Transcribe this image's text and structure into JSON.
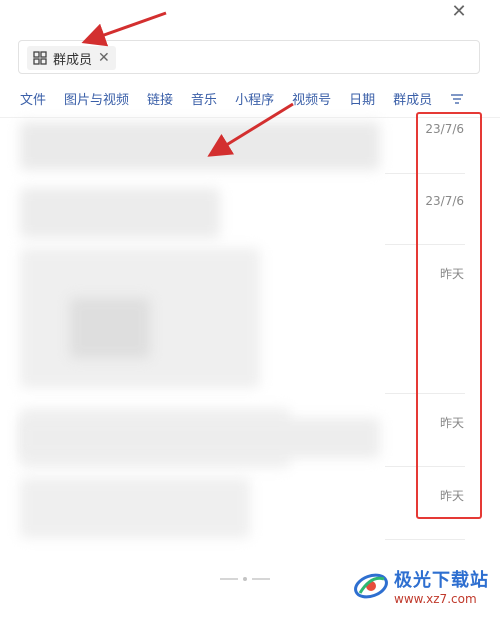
{
  "window": {
    "close_symbol": "✕"
  },
  "search": {
    "chip_label": "群成员",
    "chip_close": "✕"
  },
  "tabs": [
    {
      "label": "文件"
    },
    {
      "label": "图片与视频"
    },
    {
      "label": "链接"
    },
    {
      "label": "音乐"
    },
    {
      "label": "小程序"
    },
    {
      "label": "视频号"
    },
    {
      "label": "日期"
    },
    {
      "label": "群成员"
    }
  ],
  "results": [
    {
      "date": "23/7/6"
    },
    {
      "date": "23/7/6"
    },
    {
      "date": "昨天"
    },
    {
      "date": "昨天"
    },
    {
      "date": "昨天"
    }
  ],
  "annotations": {
    "highlight_color": "#e53935"
  },
  "watermark": {
    "title": "极光下载站",
    "url": "www.xz7.com"
  },
  "icons": [
    "grid-icon",
    "filter-icon",
    "close-icon",
    "logo-icon"
  ]
}
